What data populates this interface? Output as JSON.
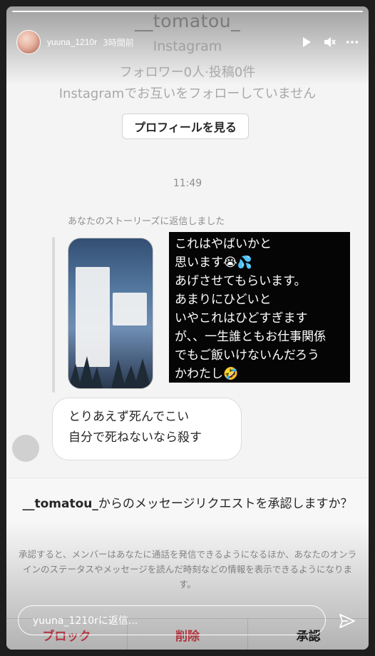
{
  "header": {
    "username": "yuuna_1210r",
    "time_ago": "3時間前"
  },
  "chat": {
    "title": "__tomatou_",
    "subtitle": "Instagram",
    "stats": "フォロワー0人·投稿0件",
    "follow_status": "Instagramでお互いをフォローしていません",
    "profile_button": "プロフィールを見る",
    "time": "11:49",
    "reply_label": "あなたのストーリーズに返信しました",
    "story_text_lines": [
      "これはやばいかと",
      "思います😭💦",
      "あげさせてもらいます。",
      "あまりにひどいと",
      "いやこれはひどすぎます",
      "が、、一生誰ともお仕事関係",
      "でもご飯いけないんだろう",
      "かわたし🤣"
    ],
    "bubble_lines": [
      "とりあえず死んでこい",
      "自分で死ねないなら殺す"
    ]
  },
  "request": {
    "username": "__tomatou_",
    "question": "からのメッセージリクエストを承認しますか？",
    "explanation": "承認すると、メンバーはあなたに通話を発信できるようになるほか、あなたのオンラインのステータスやメッセージを読んだ時刻などの情報を表示できるようになります。",
    "actions": [
      "ブロック",
      "削除",
      "承認"
    ]
  },
  "reply": {
    "placeholder": "yuuna_1210rに返信..."
  },
  "colors": {
    "danger": "#ed4956",
    "accent": "#262626"
  },
  "icons": [
    "play-icon",
    "mute-icon",
    "more-icon",
    "send-icon"
  ]
}
